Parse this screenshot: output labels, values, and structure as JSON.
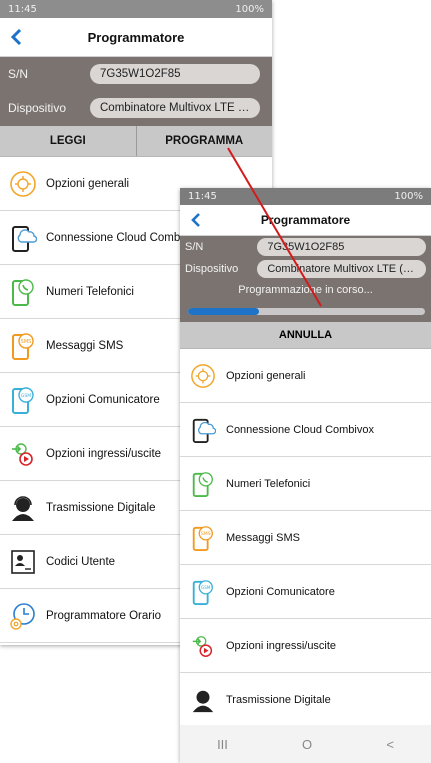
{
  "statusbar": {
    "time": "11:45",
    "battery": "100%"
  },
  "header": {
    "title": "Programmatore"
  },
  "device": {
    "sn_label": "S/N",
    "sn_value": "7G35W1O2F85",
    "device_label": "Dispositivo",
    "device_value": "Combinatore Multivox LTE (Co..."
  },
  "actions": {
    "read_label": "LEGGI",
    "program_label": "PROGRAMMA"
  },
  "menu": [
    {
      "label": "Opzioni generali",
      "icon": "gear-icon",
      "color": "#f2a62a"
    },
    {
      "label": "Connessione Cloud Combivox",
      "icon": "cloud-phone-icon",
      "color": "#4a9bd6"
    },
    {
      "label": "Numeri Telefonici",
      "icon": "phone-icon",
      "color": "#4cba4a"
    },
    {
      "label": "Messaggi SMS",
      "icon": "sms-icon",
      "color": "#f29a1e"
    },
    {
      "label": "Opzioni Comunicatore",
      "icon": "gsm-icon",
      "color": "#3ab0d8"
    },
    {
      "label": "Opzioni ingressi/uscite",
      "icon": "input-output-icon",
      "color": "#d8232a"
    },
    {
      "label": "Trasmissione Digitale",
      "icon": "headset-icon",
      "color": "#222222"
    },
    {
      "label": "Codici Utente",
      "icon": "user-code-icon",
      "color": "#222222"
    },
    {
      "label": "Programmatore Orario",
      "icon": "clock-gear-icon",
      "color": "#2a7fd0"
    }
  ],
  "overlay": {
    "progress_text": "Programmazione in corso...",
    "progress_value": 0.3,
    "cancel_label": "ANNULLA",
    "sysnav": {
      "recent": "III",
      "home": "O",
      "back": "<"
    }
  },
  "colors": {
    "accent": "#1e73c8",
    "info_bg": "#7a7370",
    "arrow": "#d21c1c"
  }
}
